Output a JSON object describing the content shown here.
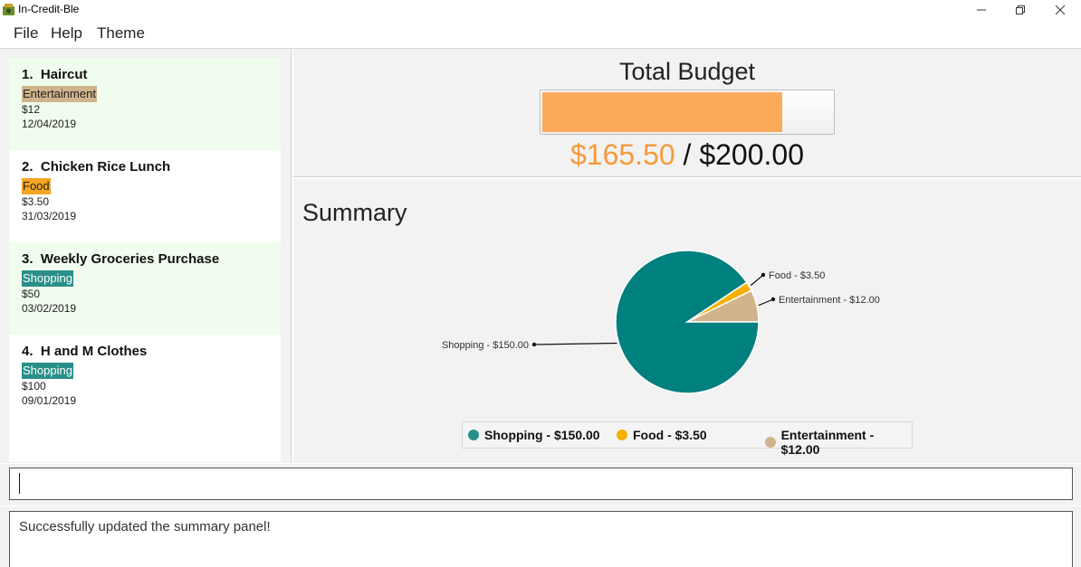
{
  "window": {
    "title": "In-Credit-Ble"
  },
  "menu": [
    "File",
    "Help",
    "Theme"
  ],
  "expenses": [
    {
      "index": "1.",
      "name": "Haircut",
      "category": "Entertainment",
      "amount": "$12",
      "date": "12/04/2019"
    },
    {
      "index": "2.",
      "name": "Chicken Rice Lunch",
      "category": "Food",
      "amount": "$3.50",
      "date": "31/03/2019"
    },
    {
      "index": "3.",
      "name": "Weekly Groceries Purchase",
      "category": "Shopping",
      "amount": "$50",
      "date": "03/02/2019"
    },
    {
      "index": "4.",
      "name": "H and M Clothes",
      "category": "Shopping",
      "amount": "$100",
      "date": "09/01/2019"
    }
  ],
  "budget": {
    "title": "Total Budget",
    "spent": "$165.50",
    "separator": "/",
    "total": "$200.00",
    "fraction": 0.8275
  },
  "summary": {
    "title": "Summary",
    "slices": [
      {
        "label": "Shopping - $150.00",
        "value": 150.0,
        "color": "#00807f"
      },
      {
        "label": "Food - $3.50",
        "value": 3.5,
        "color": "#f5b000"
      },
      {
        "label": "Entertainment - $12.00",
        "value": 12.0,
        "color": "#d2b48c"
      }
    ],
    "legend": [
      {
        "label": "Shopping - $150.00",
        "color": "#2a8f8a"
      },
      {
        "label": "Food - $3.50",
        "color": "#f5b000"
      },
      {
        "label": "Entertainment - $12.00",
        "color": "#d2b48c"
      }
    ]
  },
  "command": {
    "value": ""
  },
  "result": {
    "text": "Successfully updated the summary panel!"
  },
  "colors": {
    "entertainment": "#d2b48c",
    "food": "#f5a623",
    "shopping": "#2a8f8a",
    "spent": "#f59a3c",
    "bar": "#fbab5a"
  }
}
